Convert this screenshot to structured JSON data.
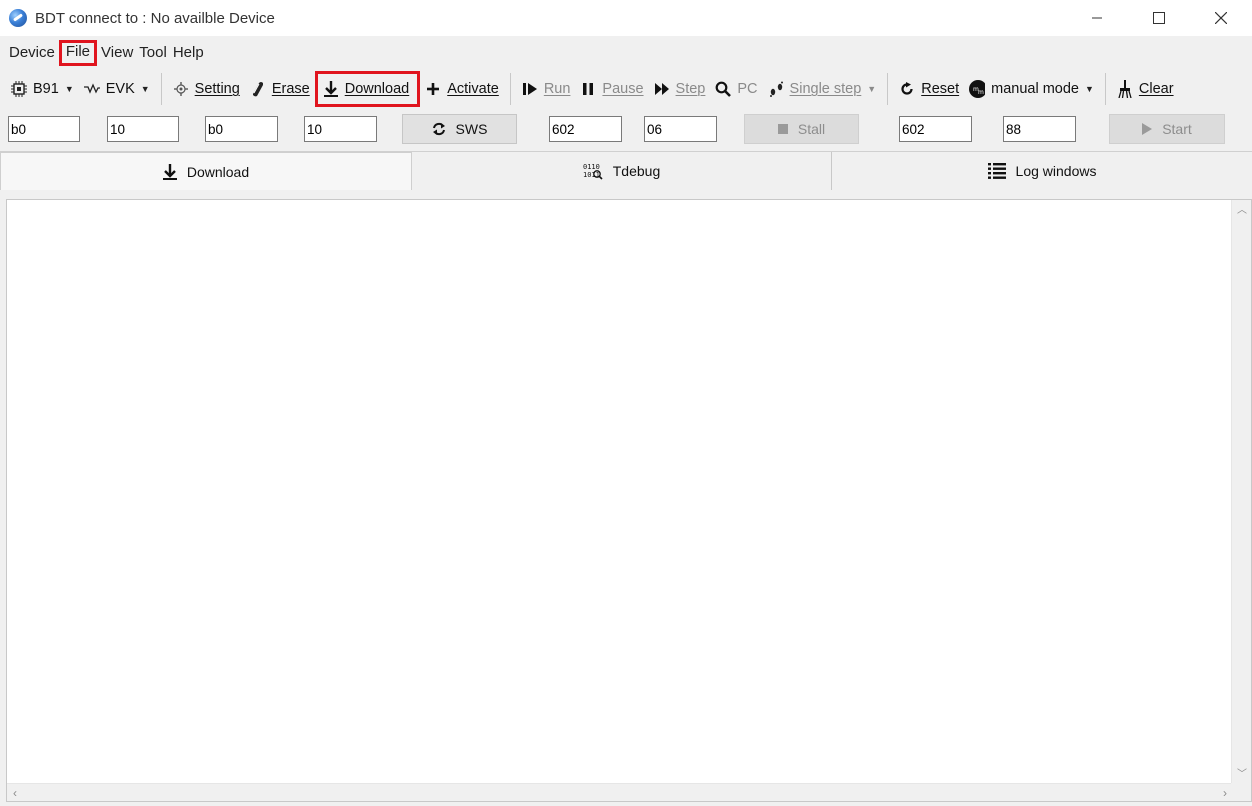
{
  "window": {
    "title": "BDT connect to : No availble Device"
  },
  "menu": [
    "Device",
    "File",
    "View",
    "Tool",
    "Help"
  ],
  "toolbar": {
    "chip": "B91",
    "board": "EVK",
    "setting": "Setting",
    "erase": "Erase",
    "download": "Download",
    "activate": "Activate",
    "run": "Run",
    "pause": "Pause",
    "step": "Step",
    "pc": "PC",
    "single_step": "Single step",
    "reset": "Reset",
    "mode": "manual mode",
    "clear": "Clear"
  },
  "inputs": {
    "f1": "b0",
    "f2": "10",
    "f3": "b0",
    "f4": "10",
    "sws": "SWS",
    "f5": "602",
    "f6": "06",
    "stall": "Stall",
    "f7": "602",
    "f8": "88",
    "start": "Start"
  },
  "tabs": [
    "Download",
    "Tdebug",
    "Log windows"
  ],
  "colors": {
    "highlight": "#e0141e",
    "background": "#f0f0f0",
    "pane": "#ffffff",
    "disabled_text": "#8a8a8a"
  },
  "icons": {
    "app": "globe-icon",
    "chip": "chip-icon",
    "board": "signal-icon",
    "setting": "gear-icon",
    "erase": "eraser-icon",
    "download": "download-arrow-icon",
    "activate": "plus-icon",
    "run": "run-icon",
    "pause": "pause-icon",
    "step": "step-icon",
    "pc": "search-icon",
    "single_step": "footsteps-icon",
    "reset": "reset-icon",
    "mode": "mode-icon",
    "clear": "broom-icon"
  }
}
